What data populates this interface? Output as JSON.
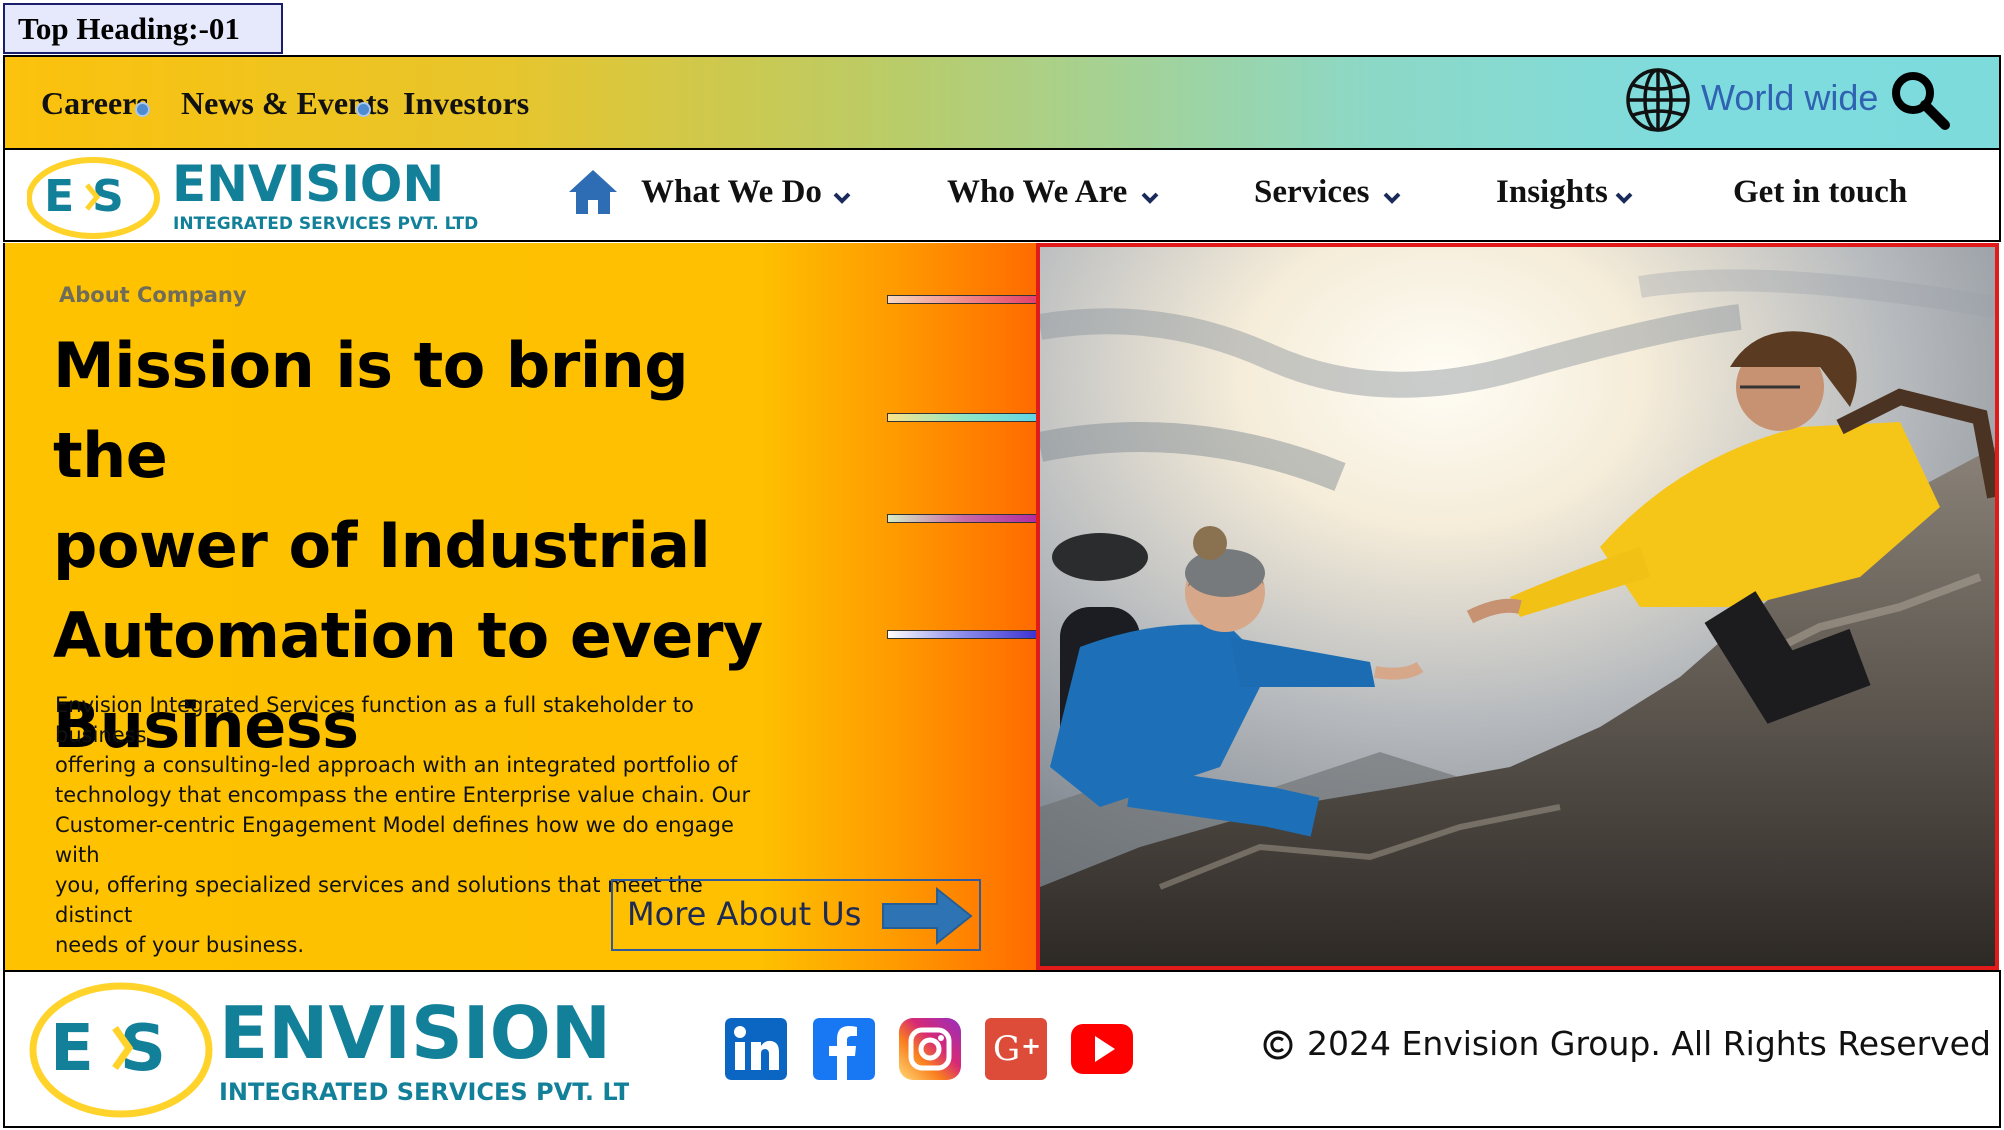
{
  "tag": {
    "label": "Top Heading:-01"
  },
  "utility_bar": {
    "links": [
      "Careers",
      "News & Events",
      "Investors"
    ],
    "region_label": "World wide",
    "icons": [
      "globe-icon",
      "search-icon"
    ]
  },
  "brand": {
    "monogram": "E S",
    "name": "ENVISION",
    "tagline": "INTEGRATED SERVICES PVT. LTD",
    "colors": {
      "teal": "#13809a",
      "yellow": "#ffd32a"
    }
  },
  "nav": {
    "items": [
      "What We Do",
      "Who We Are",
      "Services",
      "Insights",
      "Get in touch"
    ]
  },
  "hero": {
    "eyebrow": "About Company",
    "title_lines": [
      "Mission is to bring the",
      "power of Industrial",
      "Automation to every",
      "Business"
    ],
    "body_lines": [
      "Envision Integrated Services function as a full stakeholder to business,",
      "offering a consulting-led approach with an integrated portfolio of",
      "technology that encompass the entire Enterprise value chain. Our",
      "Customer-centric Engagement Model defines how we do engage with",
      "you, offering specialized services and solutions that meet the distinct",
      "needs of your business."
    ],
    "cta": "More About Us",
    "colors": {
      "orange_start": "#fec000",
      "orange_end": "#ff6a00",
      "photo_border": "#e21a1a"
    }
  },
  "footer": {
    "social_icons": [
      "linkedin-icon",
      "facebook-icon",
      "instagram-icon",
      "google-plus-icon",
      "youtube-icon"
    ],
    "copyright": "2024 Envision Group. All Rights Reserved",
    "copyright_symbol": "©"
  }
}
